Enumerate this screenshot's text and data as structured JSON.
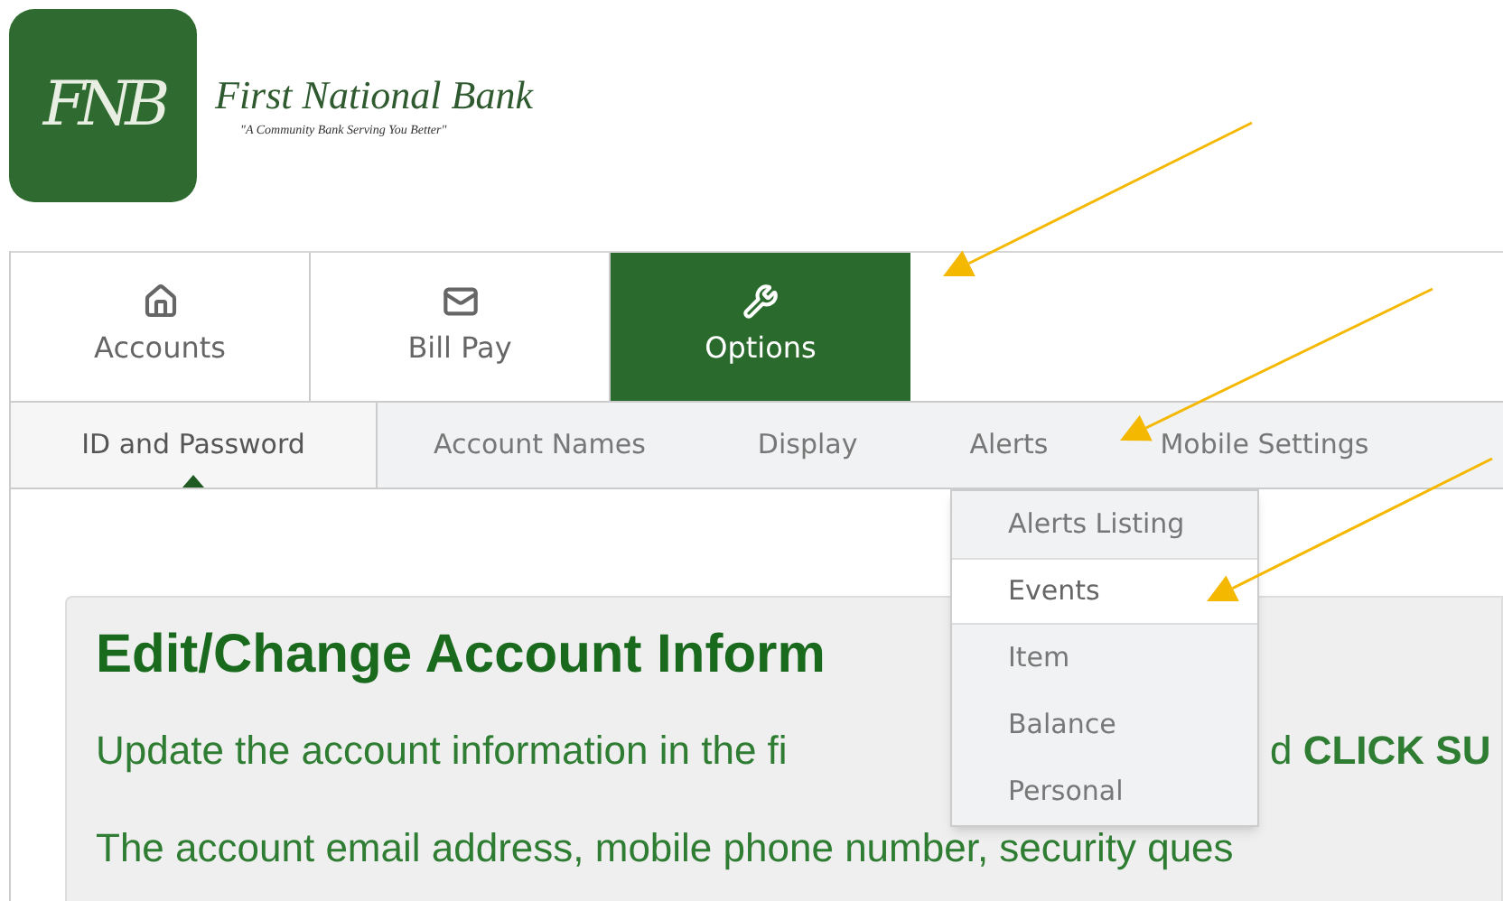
{
  "logo": {
    "monogram": "FNB",
    "name": "First National Bank",
    "tagline": "\"A Community Bank Serving You Better\""
  },
  "tabs": [
    {
      "label": "Accounts",
      "selected": false
    },
    {
      "label": "Bill Pay",
      "selected": false
    },
    {
      "label": "Options",
      "selected": true
    }
  ],
  "subnav": [
    {
      "label": "ID and Password",
      "selected": true
    },
    {
      "label": "Account Names",
      "selected": false
    },
    {
      "label": "Display",
      "selected": false
    },
    {
      "label": "Alerts",
      "selected": false
    },
    {
      "label": "Mobile Settings",
      "selected": false
    }
  ],
  "dropdown": [
    {
      "label": "Alerts Listing",
      "selected": false
    },
    {
      "label": "Events",
      "selected": true
    },
    {
      "label": "Item",
      "selected": false
    },
    {
      "label": "Balance",
      "selected": false
    },
    {
      "label": "Personal",
      "selected": false
    }
  ],
  "content": {
    "heading": "Edit/Change Account Inform",
    "line_1_left": "Update the account information in the fi",
    "line_1_right": "d **CLICK SU**",
    "line_2": "The account email address, mobile phone number, security ques"
  }
}
